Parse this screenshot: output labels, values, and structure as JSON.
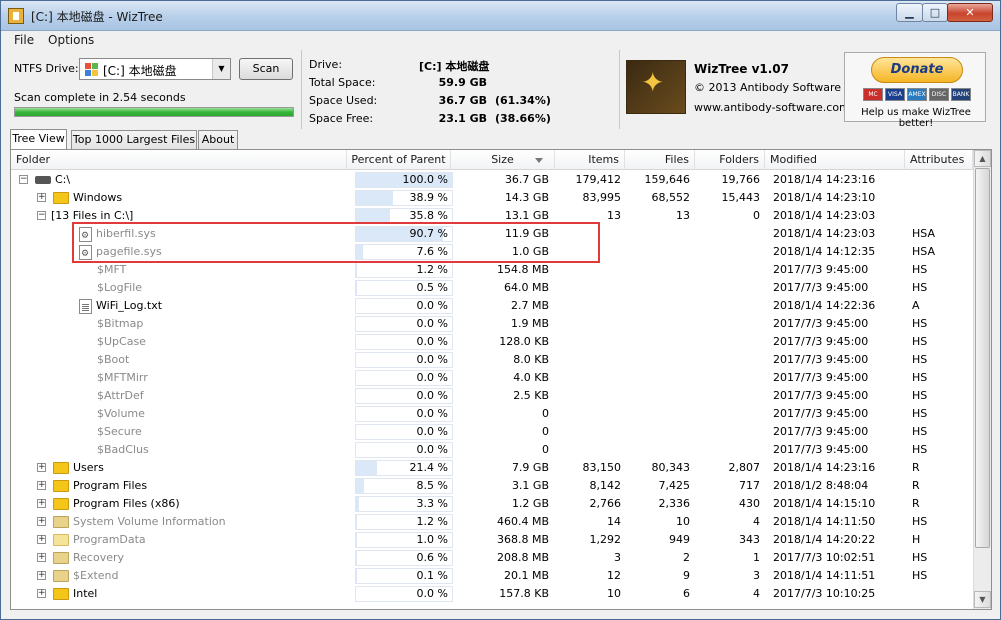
{
  "window": {
    "title": "[C:] 本地磁盘  - WizTree"
  },
  "menu": [
    "File",
    "Options"
  ],
  "header": {
    "drive_label": "NTFS Drive:",
    "drive_value": "[C:] 本地磁盘",
    "scan_label": "Scan",
    "scan_status": "Scan complete in 2.54 seconds",
    "scan_progress": 1.0,
    "stats": {
      "drive_label": "Drive:",
      "drive_value": "[C:]  本地磁盘",
      "total_label": "Total Space:",
      "total_value": "59.9 GB",
      "used_label": "Space Used:",
      "used_value": "36.7 GB",
      "used_pct": "(61.34%)",
      "free_label": "Space Free:",
      "free_value": "23.1 GB",
      "free_pct": "(38.66%)"
    },
    "app_name": "WizTree v1.07",
    "copyright": "© 2013 Antibody Software",
    "website": "www.antibody-software.com",
    "donate_label": "Donate",
    "cards": [
      "MC",
      "VISA",
      "AMEX",
      "DISC",
      "BANK"
    ],
    "donate_text": "Help us make WizTree better!"
  },
  "tabs": [
    "Tree View",
    "Top 1000 Largest Files",
    "About"
  ],
  "columns": [
    "Folder",
    "Percent of Parent",
    "Size",
    "Items",
    "Files",
    "Folders",
    "Modified",
    "Attributes"
  ],
  "rows": [
    {
      "name": "C:\\",
      "level": 0,
      "icon": "drive",
      "expander": "−",
      "pct": "100.0 %",
      "pct_value": 100.0,
      "size": "36.7 GB",
      "items": "179,412",
      "files": "159,646",
      "folders": "19,766",
      "modified": "2018/1/4 14:23:16",
      "attr": ""
    },
    {
      "name": "Windows",
      "level": 1,
      "icon": "folder",
      "expander": "+",
      "pct": "38.9 %",
      "pct_value": 38.9,
      "size": "14.3 GB",
      "items": "83,995",
      "files": "68,552",
      "folders": "15,443",
      "modified": "2018/1/4 14:23:10",
      "attr": ""
    },
    {
      "name": "[13 Files in C:\\]",
      "level": 1,
      "icon": "none",
      "expander": "−",
      "pct": "35.8 %",
      "pct_value": 35.8,
      "size": "13.1 GB",
      "items": "13",
      "files": "13",
      "folders": "0",
      "modified": "2018/1/4 14:23:03",
      "attr": ""
    },
    {
      "name": "hiberfil.sys",
      "level": 2,
      "icon": "sys",
      "gray": true,
      "pct": "90.7 %",
      "pct_value": 90.7,
      "size": "11.9 GB",
      "items": "",
      "files": "",
      "folders": "",
      "modified": "2018/1/4 14:23:03",
      "attr": "HSA"
    },
    {
      "name": "pagefile.sys",
      "level": 2,
      "icon": "sys",
      "gray": true,
      "pct": "7.6 %",
      "pct_value": 7.6,
      "size": "1.0 GB",
      "items": "",
      "files": "",
      "folders": "",
      "modified": "2018/1/4 14:12:35",
      "attr": "HSA"
    },
    {
      "name": "$MFT",
      "level": 3,
      "icon": "none",
      "gray": true,
      "pct": "1.2 %",
      "pct_value": 1.2,
      "size": "154.8 MB",
      "items": "",
      "files": "",
      "folders": "",
      "modified": "2017/7/3 9:45:00",
      "attr": "HS"
    },
    {
      "name": "$LogFile",
      "level": 3,
      "icon": "none",
      "gray": true,
      "pct": "0.5 %",
      "pct_value": 0.5,
      "size": "64.0 MB",
      "items": "",
      "files": "",
      "folders": "",
      "modified": "2017/7/3 9:45:00",
      "attr": "HS"
    },
    {
      "name": "WiFi_Log.txt",
      "level": 2,
      "icon": "txt",
      "pct": "0.0 %",
      "pct_value": 0.0,
      "size": "2.7 MB",
      "items": "",
      "files": "",
      "folders": "",
      "modified": "2018/1/4 14:22:36",
      "attr": "A"
    },
    {
      "name": "$Bitmap",
      "level": 3,
      "icon": "none",
      "gray": true,
      "pct": "0.0 %",
      "pct_value": 0.0,
      "size": "1.9 MB",
      "items": "",
      "files": "",
      "folders": "",
      "modified": "2017/7/3 9:45:00",
      "attr": "HS"
    },
    {
      "name": "$UpCase",
      "level": 3,
      "icon": "none",
      "gray": true,
      "pct": "0.0 %",
      "pct_value": 0.0,
      "size": "128.0 KB",
      "items": "",
      "files": "",
      "folders": "",
      "modified": "2017/7/3 9:45:00",
      "attr": "HS"
    },
    {
      "name": "$Boot",
      "level": 3,
      "icon": "none",
      "gray": true,
      "pct": "0.0 %",
      "pct_value": 0.0,
      "size": "8.0 KB",
      "items": "",
      "files": "",
      "folders": "",
      "modified": "2017/7/3 9:45:00",
      "attr": "HS"
    },
    {
      "name": "$MFTMirr",
      "level": 3,
      "icon": "none",
      "gray": true,
      "pct": "0.0 %",
      "pct_value": 0.0,
      "size": "4.0 KB",
      "items": "",
      "files": "",
      "folders": "",
      "modified": "2017/7/3 9:45:00",
      "attr": "HS"
    },
    {
      "name": "$AttrDef",
      "level": 3,
      "icon": "none",
      "gray": true,
      "pct": "0.0 %",
      "pct_value": 0.0,
      "size": "2.5 KB",
      "items": "",
      "files": "",
      "folders": "",
      "modified": "2017/7/3 9:45:00",
      "attr": "HS"
    },
    {
      "name": "$Volume",
      "level": 3,
      "icon": "none",
      "gray": true,
      "pct": "0.0 %",
      "pct_value": 0.0,
      "size": "0",
      "items": "",
      "files": "",
      "folders": "",
      "modified": "2017/7/3 9:45:00",
      "attr": "HS"
    },
    {
      "name": "$Secure",
      "level": 3,
      "icon": "none",
      "gray": true,
      "pct": "0.0 %",
      "pct_value": 0.0,
      "size": "0",
      "items": "",
      "files": "",
      "folders": "",
      "modified": "2017/7/3 9:45:00",
      "attr": "HS"
    },
    {
      "name": "$BadClus",
      "level": 3,
      "icon": "none",
      "gray": true,
      "pct": "0.0 %",
      "pct_value": 0.0,
      "size": "0",
      "items": "",
      "files": "",
      "folders": "",
      "modified": "2017/7/3 9:45:00",
      "attr": "HS"
    },
    {
      "name": "Users",
      "level": 1,
      "icon": "folder",
      "expander": "+",
      "pct": "21.4 %",
      "pct_value": 21.4,
      "size": "7.9 GB",
      "items": "83,150",
      "files": "80,343",
      "folders": "2,807",
      "modified": "2018/1/4 14:23:16",
      "attr": "R"
    },
    {
      "name": "Program Files",
      "level": 1,
      "icon": "folder",
      "expander": "+",
      "pct": "8.5 %",
      "pct_value": 8.5,
      "size": "3.1 GB",
      "items": "8,142",
      "files": "7,425",
      "folders": "717",
      "modified": "2018/1/2 8:48:04",
      "attr": "R"
    },
    {
      "name": "Program Files (x86)",
      "level": 1,
      "icon": "folder",
      "expander": "+",
      "pct": "3.3 %",
      "pct_value": 3.3,
      "size": "1.2 GB",
      "items": "2,766",
      "files": "2,336",
      "folders": "430",
      "modified": "2018/1/4 14:15:10",
      "attr": "R"
    },
    {
      "name": "System Volume Information",
      "level": 1,
      "icon": "special",
      "gray": true,
      "expander": "+",
      "pct": "1.2 %",
      "pct_value": 1.2,
      "size": "460.4 MB",
      "items": "14",
      "files": "10",
      "folders": "4",
      "modified": "2018/1/4 14:11:50",
      "attr": "HS"
    },
    {
      "name": "ProgramData",
      "level": 1,
      "icon": "pale",
      "gray": true,
      "expander": "+",
      "pct": "1.0 %",
      "pct_value": 1.0,
      "size": "368.8 MB",
      "items": "1,292",
      "files": "949",
      "folders": "343",
      "modified": "2018/1/4 14:20:22",
      "attr": "H"
    },
    {
      "name": "Recovery",
      "level": 1,
      "icon": "special",
      "gray": true,
      "expander": "+",
      "pct": "0.6 %",
      "pct_value": 0.6,
      "size": "208.8 MB",
      "items": "3",
      "files": "2",
      "folders": "1",
      "modified": "2017/7/3 10:02:51",
      "attr": "HS"
    },
    {
      "name": "$Extend",
      "level": 1,
      "icon": "special",
      "gray": true,
      "expander": "+",
      "pct": "0.1 %",
      "pct_value": 0.1,
      "size": "20.1 MB",
      "items": "12",
      "files": "9",
      "folders": "3",
      "modified": "2018/1/4 14:11:51",
      "attr": "HS"
    },
    {
      "name": "Intel",
      "level": 1,
      "icon": "folder",
      "expander": "+",
      "pct": "0.0 %",
      "pct_value": 0.0,
      "size": "157.8 KB",
      "items": "10",
      "files": "6",
      "folders": "4",
      "modified": "2017/7/3 10:10:25",
      "attr": ""
    }
  ]
}
